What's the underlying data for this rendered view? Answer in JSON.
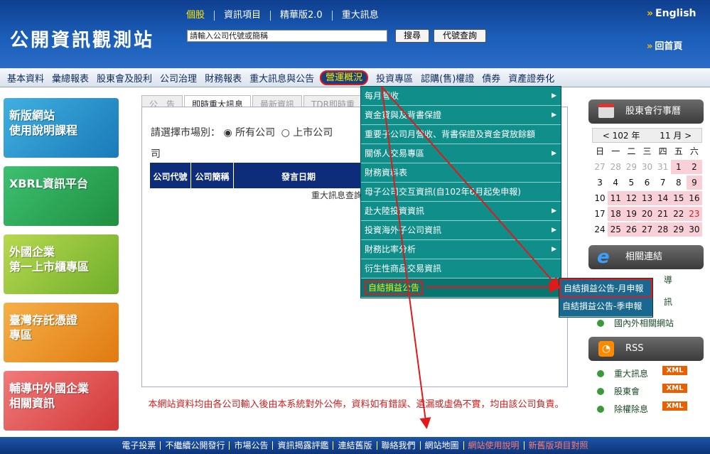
{
  "header": {
    "logo": "公開資訊觀測站",
    "top_links": [
      "個股",
      "資訊項目",
      "精華版2.0",
      "重大訊息"
    ],
    "search_placeholder": "請輸入公司代號或簡稱",
    "search_button": "搜尋",
    "code_button": "代號查詢",
    "english": "English",
    "home": "回首頁"
  },
  "nav": [
    "基本資料",
    "彙總報表",
    "股東會及股利",
    "公司治理",
    "財務報表",
    "重大訊息與公告",
    "營運概況",
    "投資專區",
    "認購(售)權證",
    "債券",
    "資產證券化"
  ],
  "left_banners": [
    {
      "text": "新版網站\n使用說明課程"
    },
    {
      "text": "XBRL資訊平台"
    },
    {
      "text": "外國企業\n第一上市櫃專區"
    },
    {
      "text": "臺灣存託憑證\n專區"
    },
    {
      "text": "輔導中外國企業\n相關資訊"
    }
  ],
  "main": {
    "tabs": [
      "公　告",
      "即時重大訊息",
      "最新資訊",
      "TDR即時重"
    ],
    "choose_label": "請選擇市場別：",
    "opt_all": "所有公司",
    "opt_listed": "上市公司",
    "wrap_text": "司",
    "table_headers": [
      "公司代號",
      "公司簡稱",
      "發言日期"
    ],
    "notice": "重大訊息查詢"
  },
  "dropdown": [
    {
      "label": "每月營收",
      "sub": true
    },
    {
      "label": "資金貸與及背書保證",
      "sub": true
    },
    {
      "label": "重要子公司月營收、背書保證及資金貸放餘額",
      "sub": false
    },
    {
      "label": "關係人交易專區",
      "sub": true
    },
    {
      "label": "財務資料表",
      "sub": false
    },
    {
      "label": "母子公司交互資訊(自102年6月起免申報)",
      "sub": false
    },
    {
      "label": "赴大陸投資資訊",
      "sub": true
    },
    {
      "label": "投資海外子公司資訊",
      "sub": true
    },
    {
      "label": "財務比率分析",
      "sub": true
    },
    {
      "label": "衍生性商品交易資訊",
      "sub": false
    },
    {
      "label": "自結損益公告",
      "sub": true
    }
  ],
  "submenu": [
    "自結損益公告-月申報",
    "自結損益公告-季申報"
  ],
  "right": {
    "calendar_title": "股東會行事曆",
    "cal_year": "102",
    "cal_year_unit": "年",
    "cal_month": "11",
    "cal_month_unit": "月",
    "weekdays": [
      "日",
      "一",
      "二",
      "三",
      "四",
      "五",
      "六"
    ],
    "days": [
      "27",
      "28",
      "29",
      "30",
      "31",
      "1",
      "2",
      "3",
      "4",
      "5",
      "6",
      "7",
      "8",
      "9",
      "10",
      "11",
      "12",
      "13",
      "14",
      "15",
      "16",
      "17",
      "18",
      "19",
      "20",
      "21",
      "22",
      "23",
      "24",
      "25",
      "26",
      "27",
      "28",
      "29",
      "30"
    ],
    "links_title": "相關連結",
    "links": [
      "導",
      "訊",
      "國內外相關網站"
    ],
    "rss_title": "RSS",
    "rss_items": [
      "重大訊息",
      "股東會",
      "除權除息"
    ],
    "xml_label": "XML"
  },
  "disclaimer": "本網站資料均由各公司輸入後由本系統對外公佈，資料如有錯誤、遺漏或虛偽不實，均由該公司負責。",
  "footer": [
    "電子投票",
    "不繼續公開發行",
    "市場公告",
    "資訊揭露評鑑",
    "連結舊版",
    "聯絡我們",
    "網站地圖",
    "網站使用說明",
    "新舊版項目對照"
  ],
  "colors": {
    "nav_active_border": "#e31818",
    "menu_bg": "#0f8e8a",
    "header_bg": "#1b5eb9"
  }
}
